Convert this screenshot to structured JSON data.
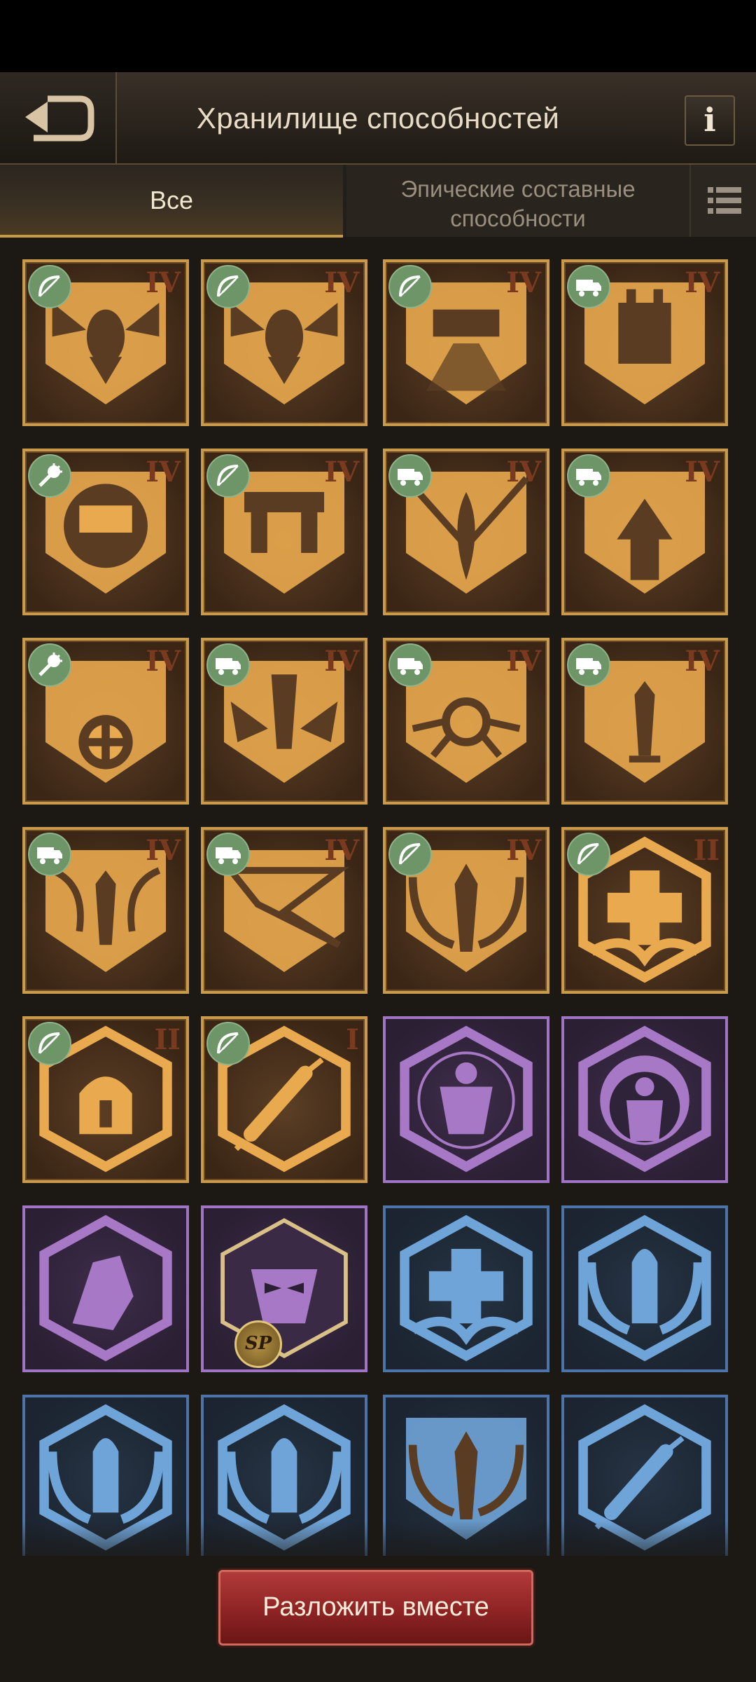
{
  "header": {
    "title": "Хранилище способностей",
    "back_icon": "back-arrow-icon",
    "info_label": "i"
  },
  "tabs": [
    {
      "label": "Все",
      "active": true
    },
    {
      "label": "Эпические составные способности",
      "active": false
    }
  ],
  "colors": {
    "gold_border": "#c99a4c",
    "gold_art": "#e9a94e",
    "purple_art": "#a778c5",
    "blue_art": "#6fa4d8",
    "button_red": "#9a2828",
    "badge_green": "#6d9568"
  },
  "cards": [
    {
      "tier": "gold",
      "badge": "bow",
      "level": "IV",
      "icon": "wings-emblem"
    },
    {
      "tier": "gold",
      "badge": "bow",
      "level": "IV",
      "icon": "wings-emblem"
    },
    {
      "tier": "gold",
      "badge": "bow",
      "level": "IV",
      "icon": "fortress-rays"
    },
    {
      "tier": "gold",
      "badge": "truck",
      "level": "IV",
      "icon": "fortress-tower"
    },
    {
      "tier": "gold",
      "badge": "mace",
      "level": "IV",
      "icon": "fortress-dome"
    },
    {
      "tier": "gold",
      "badge": "bow",
      "level": "IV",
      "icon": "fortress-gate"
    },
    {
      "tier": "gold",
      "badge": "truck",
      "level": "IV",
      "icon": "flame-chevron"
    },
    {
      "tier": "gold",
      "badge": "truck",
      "level": "IV",
      "icon": "arrow-up-chevron"
    },
    {
      "tier": "gold",
      "badge": "mace",
      "level": "IV",
      "icon": "wheel-chevron"
    },
    {
      "tier": "gold",
      "badge": "truck",
      "level": "IV",
      "icon": "wings-shield"
    },
    {
      "tier": "gold",
      "badge": "truck",
      "level": "IV",
      "icon": "ring-rays"
    },
    {
      "tier": "gold",
      "badge": "truck",
      "level": "IV",
      "icon": "sword-rays"
    },
    {
      "tier": "gold",
      "badge": "truck",
      "level": "IV",
      "icon": "sword-swirl"
    },
    {
      "tier": "gold",
      "badge": "truck",
      "level": "IV",
      "icon": "broken-shield"
    },
    {
      "tier": "gold",
      "badge": "bow",
      "level": "IV",
      "icon": "sword-wings"
    },
    {
      "tier": "gold",
      "badge": "bow",
      "level": "II",
      "icon": "medical-cross"
    },
    {
      "tier": "gold",
      "badge": "bow",
      "level": "II",
      "icon": "helmet-burst"
    },
    {
      "tier": "gold",
      "badge": "bow",
      "level": "I",
      "icon": "syringe"
    },
    {
      "tier": "purple",
      "badge": "",
      "level": "",
      "icon": "strongman"
    },
    {
      "tier": "purple",
      "badge": "",
      "level": "",
      "icon": "crescent-figure"
    },
    {
      "tier": "purple",
      "badge": "",
      "level": "",
      "icon": "fist-burst"
    },
    {
      "tier": "purple",
      "badge": "",
      "level": "",
      "icon": "mask",
      "sp": "SP"
    },
    {
      "tier": "blue",
      "badge": "",
      "level": "",
      "icon": "medical-cross"
    },
    {
      "tier": "blue",
      "badge": "",
      "level": "",
      "icon": "bullet"
    },
    {
      "tier": "blue",
      "badge": "",
      "level": "",
      "icon": "bullet"
    },
    {
      "tier": "blue",
      "badge": "",
      "level": "",
      "icon": "bullet"
    },
    {
      "tier": "blue",
      "badge": "",
      "level": "",
      "icon": "sword-wings"
    },
    {
      "tier": "blue",
      "badge": "",
      "level": "",
      "icon": "syringe"
    }
  ],
  "action_button": {
    "label": "Разложить вместе"
  }
}
